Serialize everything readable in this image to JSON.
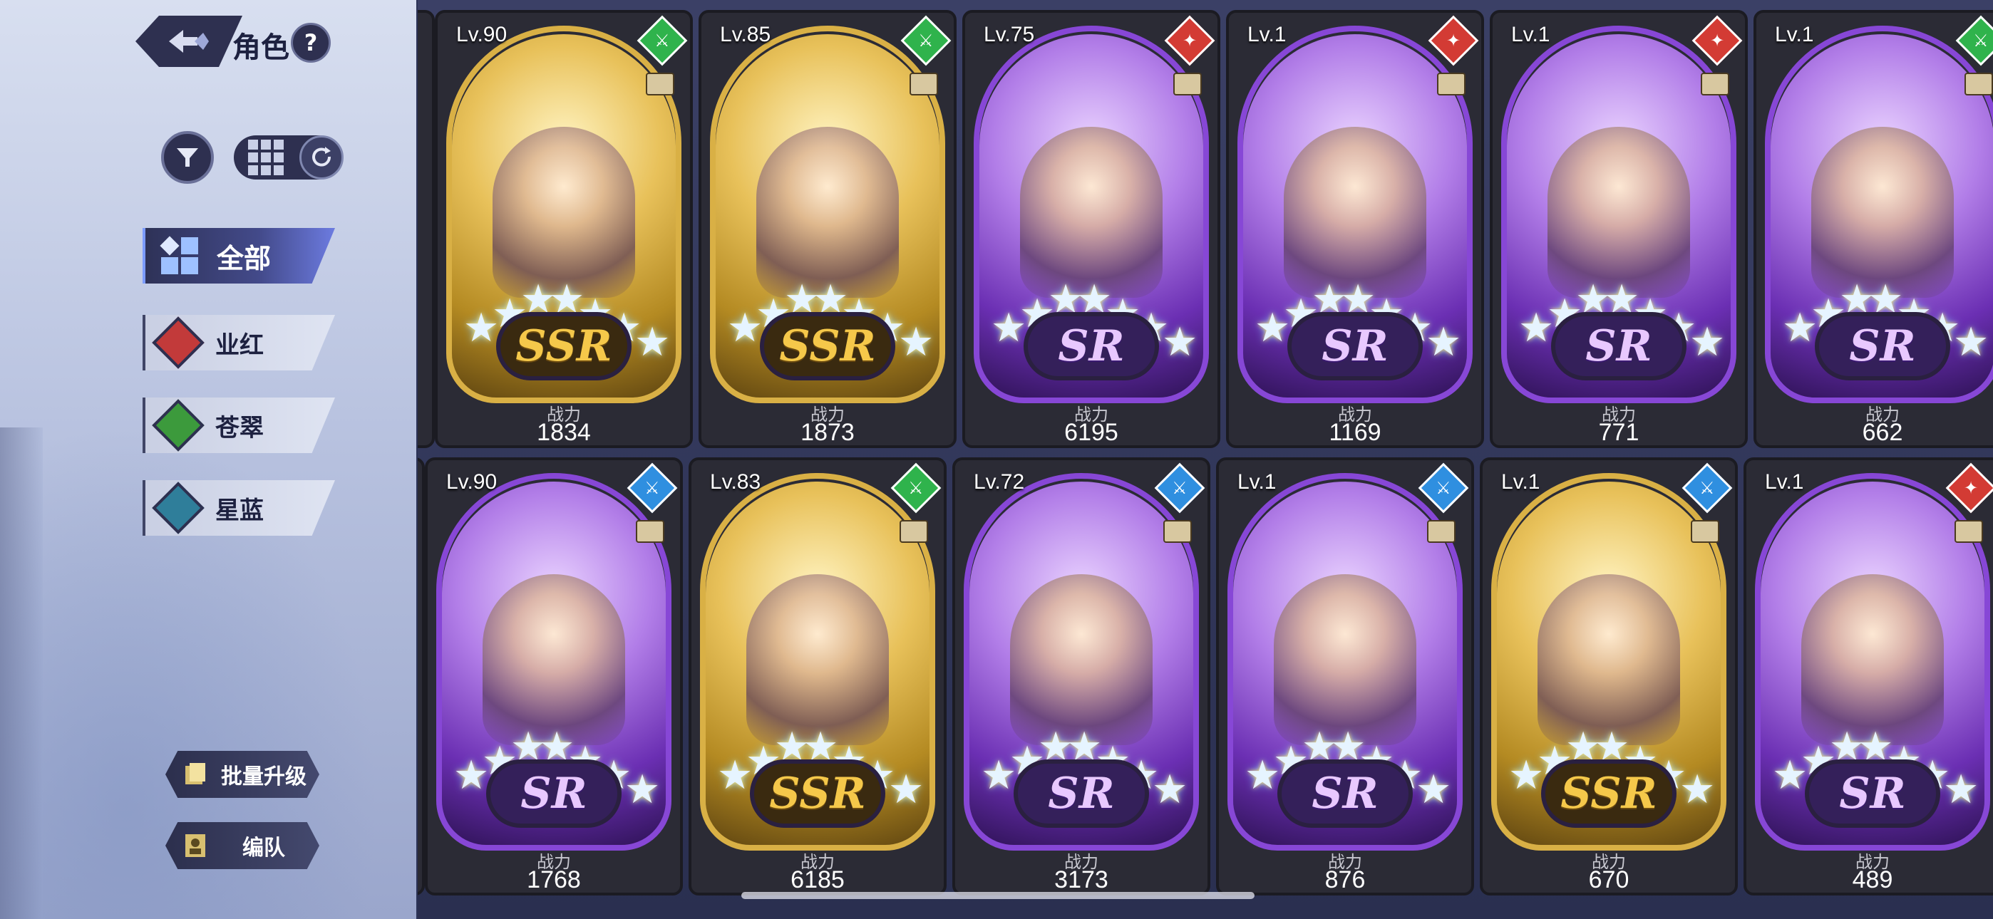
{
  "header": {
    "title": "角色",
    "help": "?"
  },
  "categories": [
    {
      "label": "全部",
      "color": "#6c7be0",
      "active": true
    },
    {
      "label": "业红",
      "color": "#c23a3a",
      "active": false
    },
    {
      "label": "苍翠",
      "color": "#3c9a3c",
      "active": false
    },
    {
      "label": "星蓝",
      "color": "#2f7e9a",
      "active": false
    }
  ],
  "actions": {
    "batch_upgrade": "批量升级",
    "team": "编队"
  },
  "power_label": "战力",
  "cards": [
    {
      "level": "Lv.90",
      "rarity": "SSR",
      "element": "green",
      "power": "1834"
    },
    {
      "level": "Lv.85",
      "rarity": "SSR",
      "element": "green",
      "power": "1873"
    },
    {
      "level": "Lv.75",
      "rarity": "SR",
      "element": "red",
      "power": "6195"
    },
    {
      "level": "Lv.1",
      "rarity": "SR",
      "element": "red",
      "power": "1169"
    },
    {
      "level": "Lv.1",
      "rarity": "SR",
      "element": "red",
      "power": "771"
    },
    {
      "level": "Lv.1",
      "rarity": "SR",
      "element": "green",
      "power": "662"
    },
    {
      "level": "Lv.90",
      "rarity": "SR",
      "element": "blue",
      "power": "1768"
    },
    {
      "level": "Lv.83",
      "rarity": "SSR",
      "element": "green",
      "power": "6185"
    },
    {
      "level": "Lv.72",
      "rarity": "SR",
      "element": "blue",
      "power": "3173"
    },
    {
      "level": "Lv.1",
      "rarity": "SR",
      "element": "blue",
      "power": "876"
    },
    {
      "level": "Lv.1",
      "rarity": "SSR",
      "element": "blue",
      "power": "670"
    },
    {
      "level": "Lv.1",
      "rarity": "SR",
      "element": "red",
      "power": "489"
    }
  ]
}
